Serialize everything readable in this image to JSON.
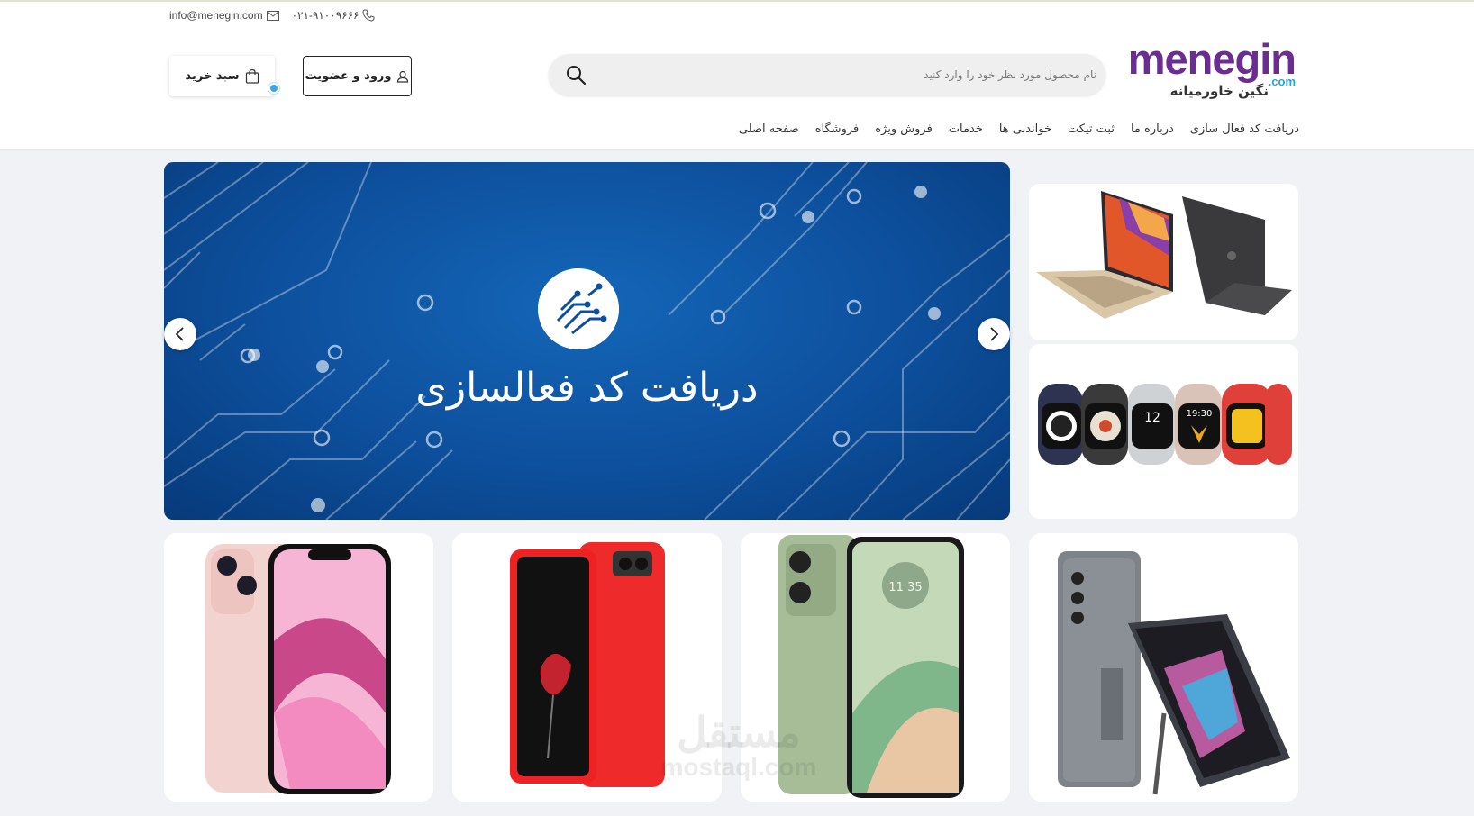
{
  "header": {
    "email": "info@menegin.com",
    "phone": "۰۲۱-۹۱۰۰۹۶۶۶",
    "logo": {
      "word": "menegin",
      "domain": ".com",
      "subtitle": "نگین خاورمیانه"
    },
    "search": {
      "placeholder": "نام محصول مورد نظر خود را وارد کنید"
    },
    "login_label": "ورود و عضویت",
    "cart_label": "سبد خرید"
  },
  "nav": {
    "items": [
      "صفحه اصلی",
      "فروشگاه",
      "فروش ویژه",
      "خدمات",
      "خواندنی ها",
      "ثبت تیکت",
      "درباره ما",
      "دریافت کد فعال سازی"
    ]
  },
  "banner": {
    "title": "دریافت کد فعالسازی"
  },
  "side_cards": [
    {
      "icon": "laptop-image"
    },
    {
      "icon": "smartwatch-image",
      "watch_times": [
        "12",
        "19:30"
      ]
    }
  ],
  "products": [
    {
      "icon": "foldable-phone-image"
    },
    {
      "icon": "green-phone-image",
      "clock": "11 35"
    },
    {
      "icon": "red-phone-image"
    },
    {
      "icon": "pink-iphone-image"
    }
  ],
  "watermark": {
    "arabic": "مستقل",
    "latin": "mostaql.com"
  },
  "colors": {
    "brand": "#6b2d91",
    "accent": "#2aa3dc",
    "banner": "#0d4f9c"
  }
}
